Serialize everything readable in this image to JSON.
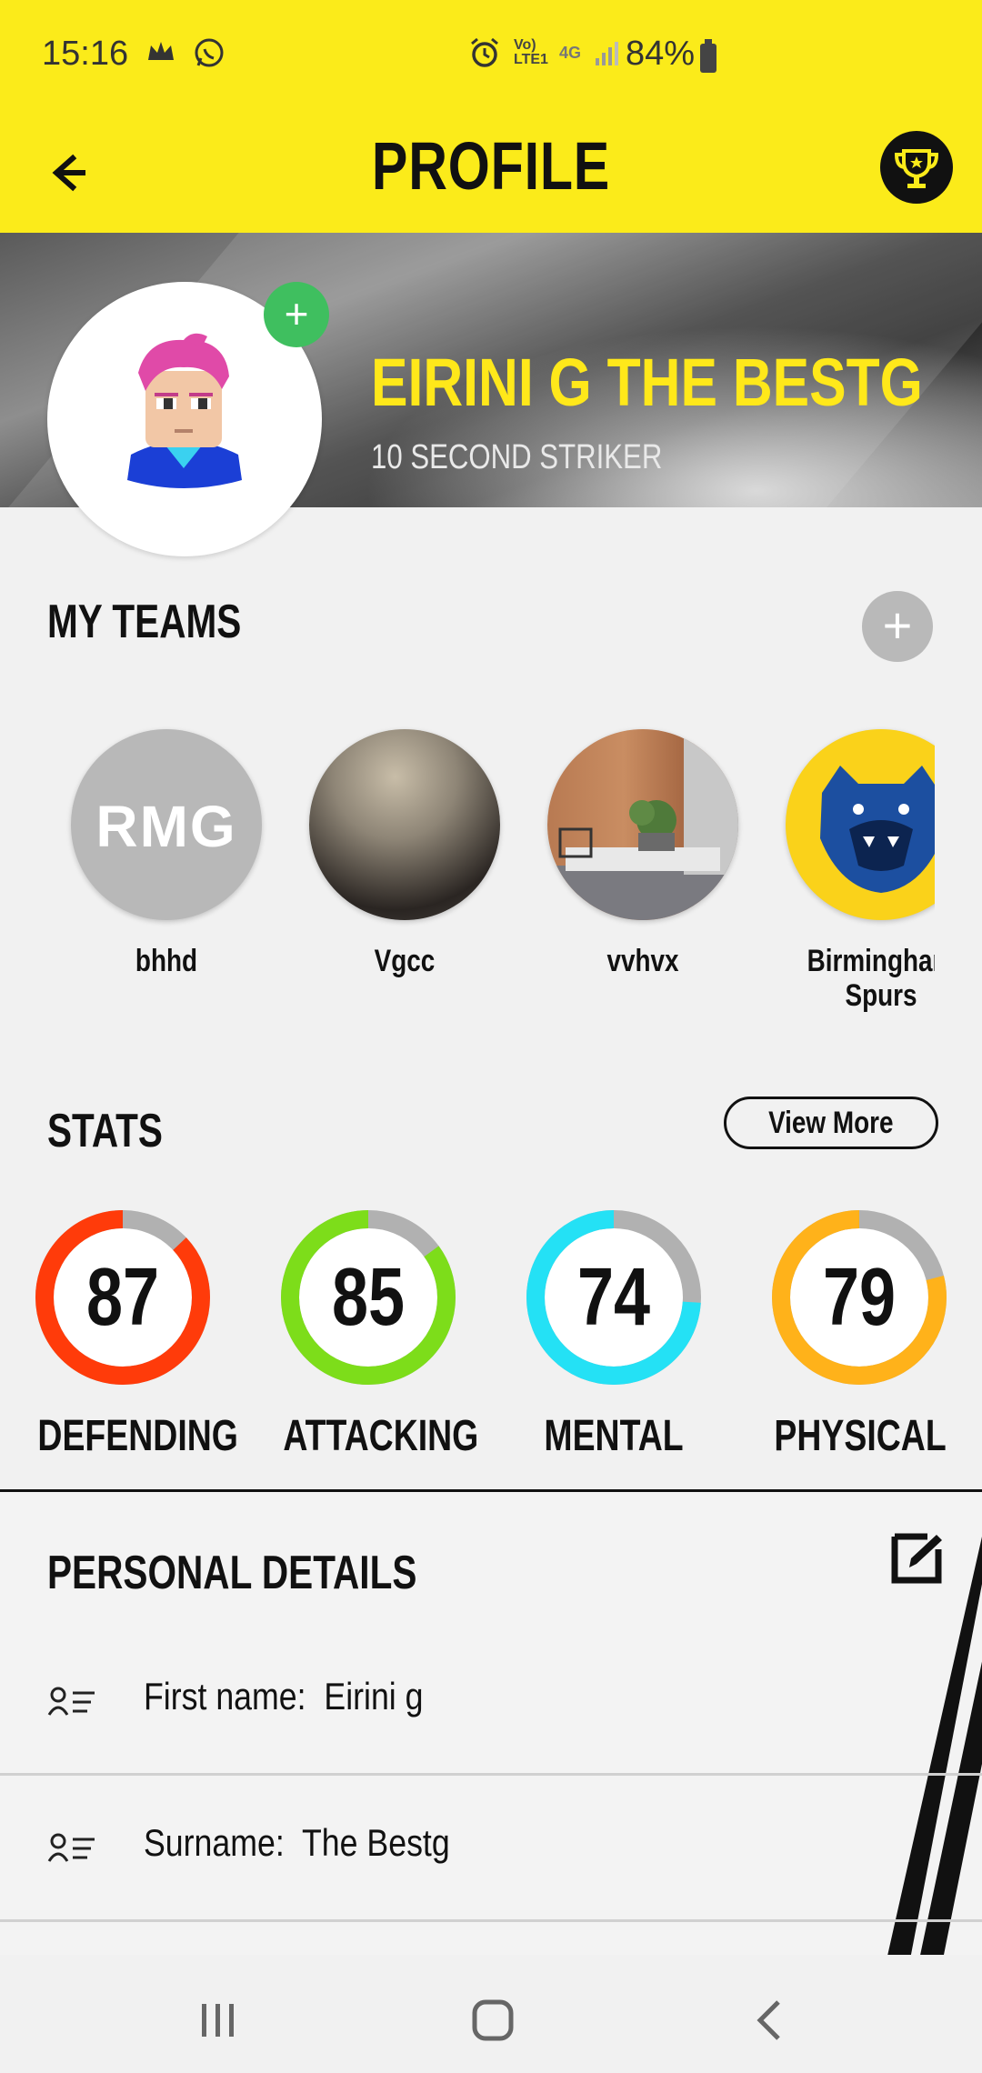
{
  "status_bar": {
    "time": "15:16",
    "battery": "84%",
    "network": "4G",
    "volte": "Vo) LTE1"
  },
  "header": {
    "title": "PROFILE",
    "back_icon": "arrow-left-icon",
    "trophy_icon": "trophy-icon"
  },
  "profile": {
    "name": "EIRINI G THE BESTG",
    "role": "10 SECOND STRIKER",
    "add_photo_icon": "plus-icon"
  },
  "teams": {
    "title": "MY TEAMS",
    "items": [
      {
        "name": "bhhd",
        "logo_text": "RMG"
      },
      {
        "name": "Vgcc"
      },
      {
        "name": "vvhvx"
      },
      {
        "name": "Birmingham Spurs"
      }
    ]
  },
  "stats": {
    "title": "STATS",
    "view_more": "View More",
    "items": [
      {
        "label": "DEFENDING",
        "value": "87",
        "color": "#ff3b0a"
      },
      {
        "label": "ATTACKING",
        "value": "85",
        "color": "#7ddd1a"
      },
      {
        "label": "MENTAL",
        "value": "74",
        "color": "#24e1f5"
      },
      {
        "label": "PHYSICAL",
        "value": "79",
        "color": "#ffb21a"
      }
    ]
  },
  "personal_details": {
    "title": "PERSONAL DETAILS",
    "rows": [
      {
        "label": "First name:",
        "value": "Eirini g"
      },
      {
        "label": "Surname:",
        "value": "The Bestg"
      }
    ]
  },
  "colors": {
    "accent": "#fbeb1a",
    "name_yellow": "#ffe81a"
  }
}
